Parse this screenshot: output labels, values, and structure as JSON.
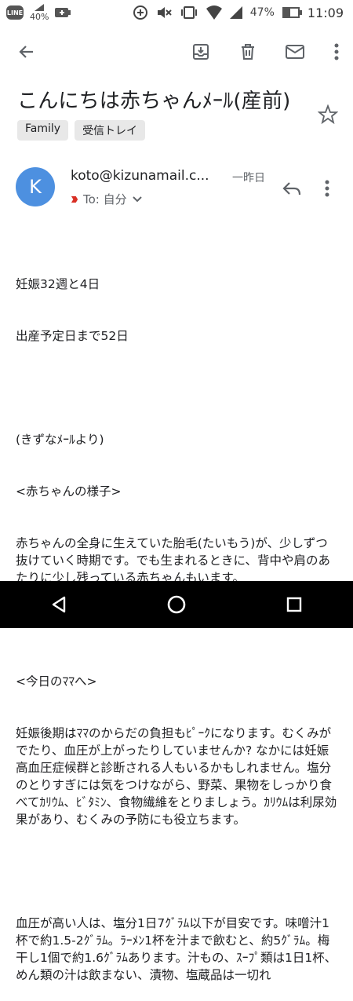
{
  "status_bar": {
    "app_icon_text": "LINE",
    "data_saver": "40%",
    "battery_percent": "47%",
    "time": "11:09"
  },
  "toolbar": {
    "back": "arrow-back-icon",
    "archive": "archive-icon",
    "delete": "trash-icon",
    "mark_unread": "mail-icon",
    "more": "more-vert-icon"
  },
  "email": {
    "subject": "こんにちは赤ちゃんﾒｰﾙ(産前)",
    "labels": [
      "Family",
      "受信トレイ"
    ],
    "sender": {
      "avatar_letter": "K",
      "address": "koto@kizunamail.c...",
      "date": "一昨日",
      "recipient": "To: 自分"
    },
    "body_lines": [
      "妊娠32週と4日",
      "出産予定日まで52日",
      "",
      "(きずなﾒｰﾙより)",
      "<赤ちゃんの様子>",
      "赤ちゃんの全身に生えていた胎毛(たいもう)が、少しずつ抜けていく時期です。でも生まれるときに、背中や肩のあたりに少し残っている赤ちゃんもいます。",
      "",
      "<今日のﾏﾏへ>",
      "妊娠後期はﾏﾏのからだの負担もﾋﾟｰｸになります。むくみがでたり、血圧が上がったりしていませんか? なかには妊娠高血圧症候群と診断される人もいるかもしれません。塩分のとりすぎには気をつけながら、野菜、果物をしっかり食べてｶﾘｳﾑ、ﾋﾞﾀﾐﾝ、食物繊維をとりましょう。ｶﾘｳﾑは利尿効果があり、むくみの予防にも役立ちます。",
      "",
      "血圧が高い人は、塩分1日7ｸﾞﾗﾑ以下が目安です。味噌汁1杯で約1.5-2ｸﾞﾗﾑ。ﾗｰﾒﾝ1杯を汁まで飲むと、約5ｸﾞﾗﾑ。梅干し1個で約1.6ｸﾞﾗﾑあります。汁もの、ｽｰﾌﾟ類は1日1杯、めん類の汁は飲まない、漬物、塩蔵品は一切れ"
    ]
  }
}
